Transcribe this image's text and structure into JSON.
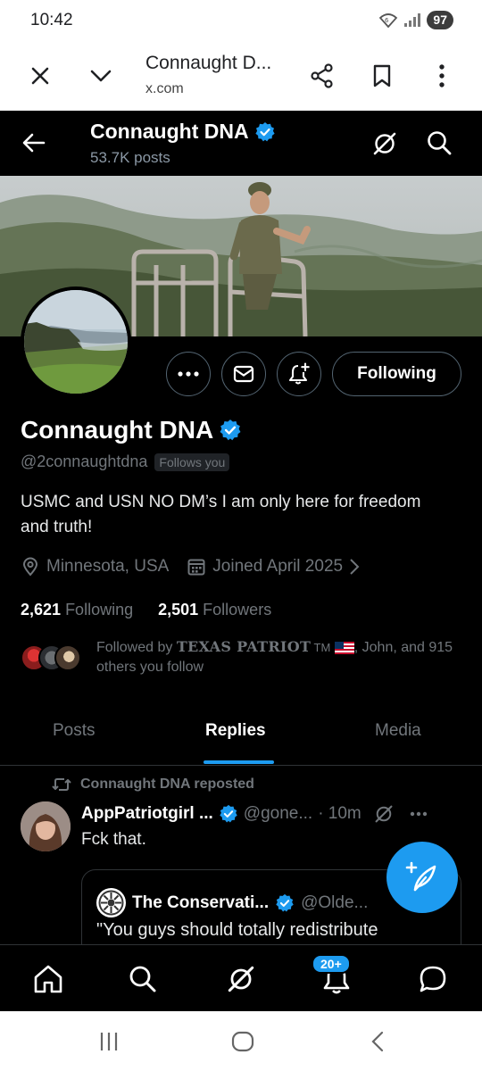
{
  "status_bar": {
    "time": "10:42",
    "battery": "97"
  },
  "browser": {
    "title": "Connaught D...",
    "url": "x.com"
  },
  "header": {
    "name": "Connaught DNA",
    "posts": "53.7K posts"
  },
  "profile": {
    "name": "Connaught DNA",
    "handle": "@2connaughtdna",
    "follows_you": "Follows you",
    "bio": "USMC and USN NO DM’s I am only here for freedom and truth!",
    "location": "Minnesota, USA",
    "joined": "Joined April 2025",
    "following_count": "2,621",
    "following_label": "Following",
    "followers_count": "2,501",
    "followers_label": "Followers",
    "followed_by_prefix": "Followed by ",
    "followed_by_patriot": "TEXAS PATRIOT",
    "followed_by_tm": " TM",
    "followed_by_rest": ", John, and 915 others you follow",
    "following_button": "Following"
  },
  "tabs": [
    {
      "label": "Posts"
    },
    {
      "label": "Replies"
    },
    {
      "label": "Media"
    }
  ],
  "tweet": {
    "repost_label": "Connaught DNA reposted",
    "name": "AppPatriotgirl ...",
    "handle": "@gone...",
    "time": "· 10m",
    "text": "Fck that.",
    "quote": {
      "name": "The Conservati...",
      "handle": "@Olde...",
      "text": "\"You guys should totally redistribute"
    }
  },
  "bottom_nav": {
    "notifications_badge": "20+"
  },
  "colors": {
    "accent": "#1d9bf0",
    "background": "#000000",
    "muted": "#71767b"
  }
}
